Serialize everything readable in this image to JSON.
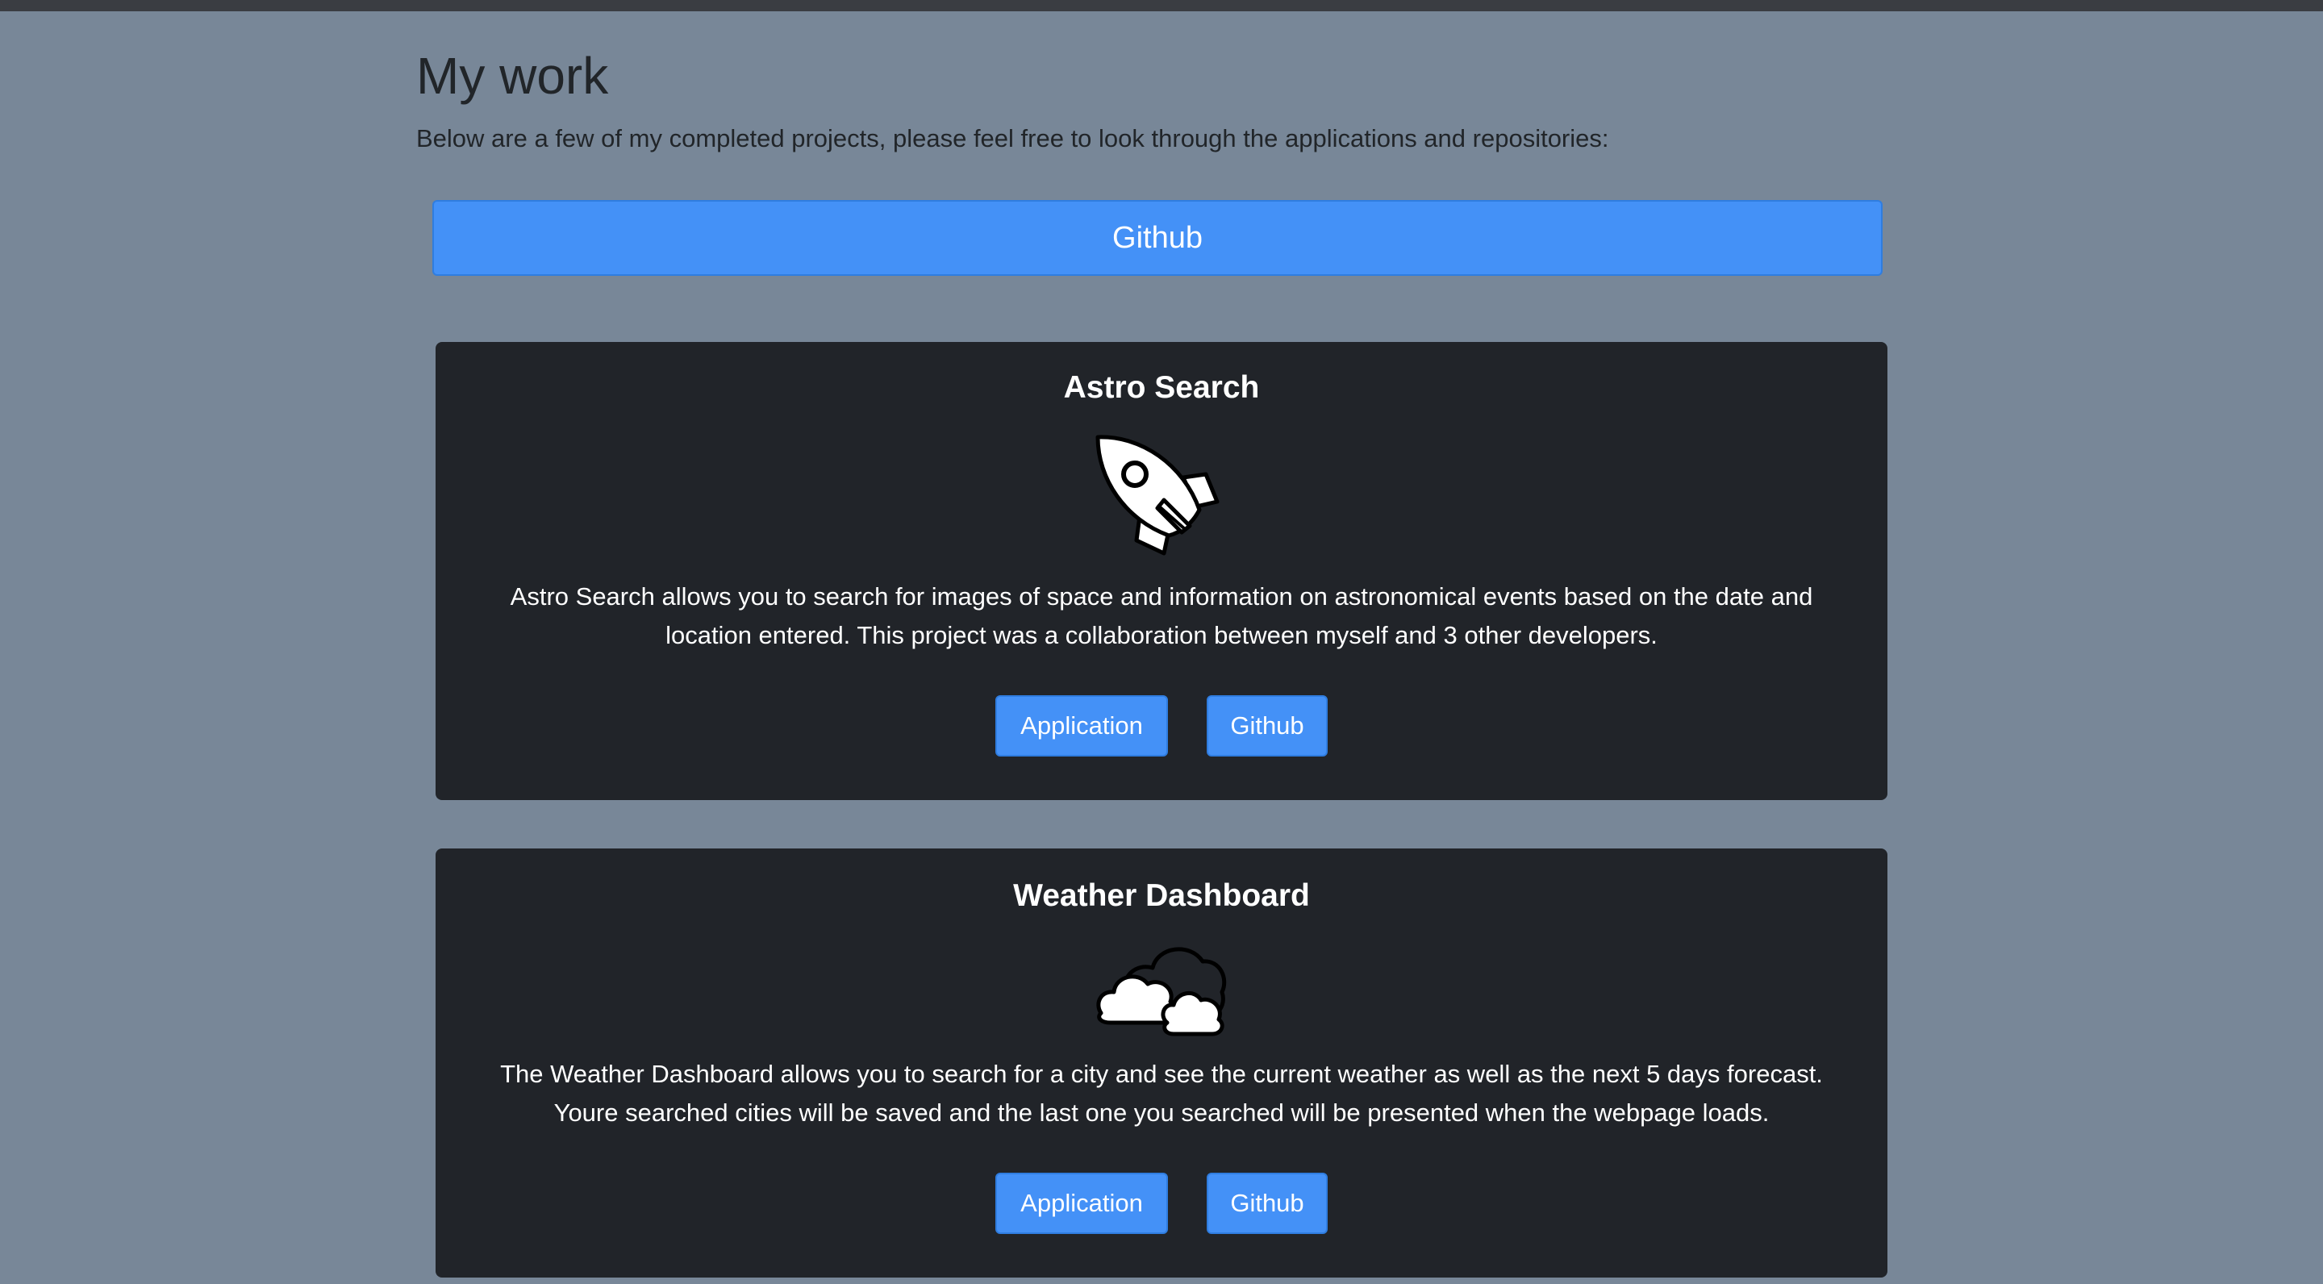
{
  "header": {
    "title": "My work",
    "intro": "Below are a few of my completed projects, please feel free to look through the applications and repositories:"
  },
  "main_github_label": "Github",
  "projects": [
    {
      "title": "Astro Search",
      "icon": "rocket-icon",
      "description": "Astro Search allows you to search for images of space and information on astronomical events based on the date and location entered. This project was a collaboration between myself and 3 other developers.",
      "application_label": "Application",
      "github_label": "Github"
    },
    {
      "title": "Weather Dashboard",
      "icon": "cloud-icon",
      "description": "The Weather Dashboard allows you to search for a city and see the current weather as well as the next 5 days forecast. Youre searched cities will be saved and the last one you searched will be presented when the webpage loads.",
      "application_label": "Application",
      "github_label": "Github"
    }
  ],
  "colors": {
    "background": "#788798",
    "card": "#212429",
    "button": "#4491f7",
    "text_dark": "#212529"
  }
}
